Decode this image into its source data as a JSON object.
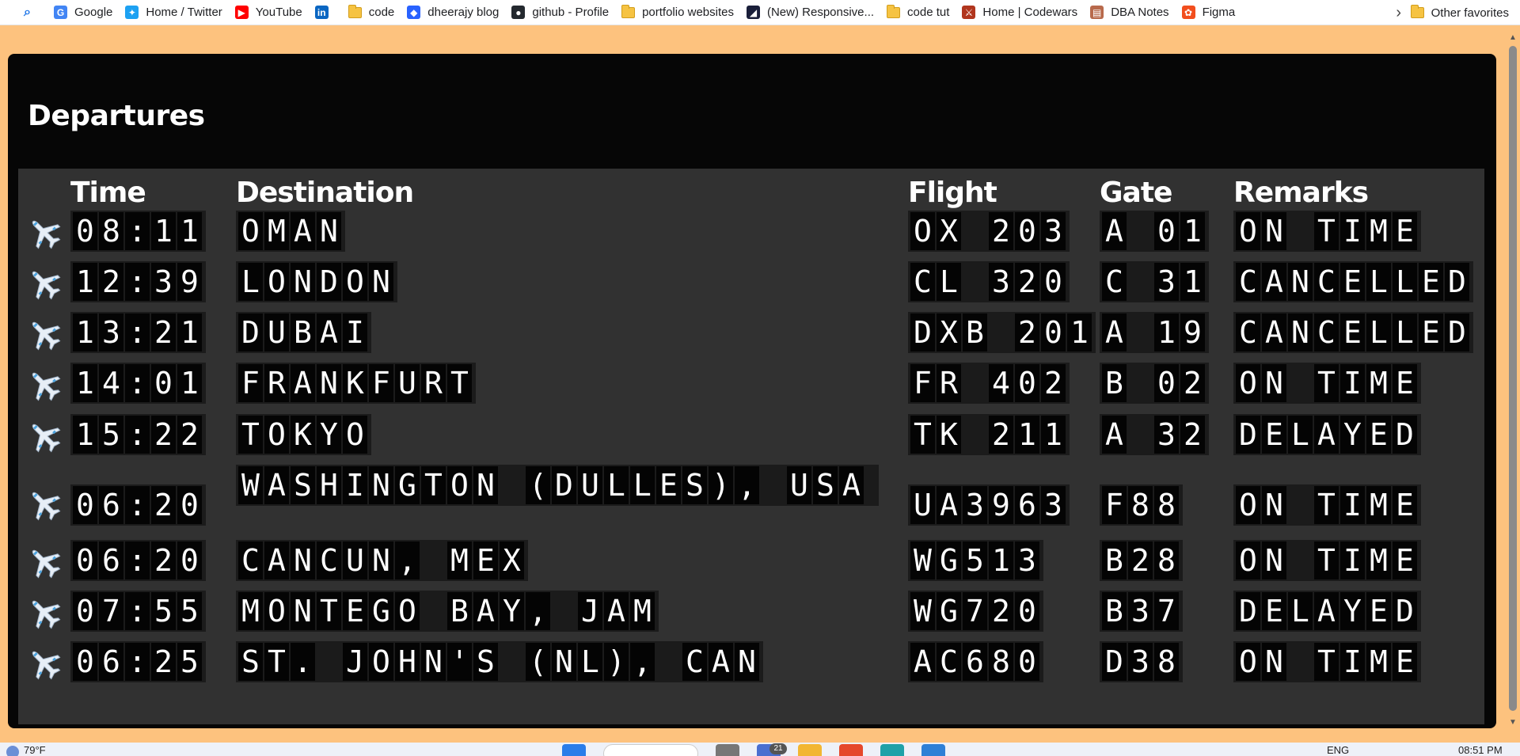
{
  "bookmarks": [
    {
      "label": "",
      "icon": "search-icon",
      "kind": "search"
    },
    {
      "label": "Google",
      "icon": "google-icon",
      "kind": "logo",
      "color": "#4285f4",
      "glyph": "G"
    },
    {
      "label": "Home / Twitter",
      "icon": "twitter-icon",
      "kind": "logo",
      "color": "#1da1f2",
      "glyph": "✦"
    },
    {
      "label": "YouTube",
      "icon": "youtube-icon",
      "kind": "logo",
      "color": "#ff0000",
      "glyph": "▶"
    },
    {
      "label": "",
      "icon": "linkedin-icon",
      "kind": "logo",
      "color": "#0a66c2",
      "glyph": "in"
    },
    {
      "label": "code",
      "icon": "folder-icon",
      "kind": "folder"
    },
    {
      "label": "dheerajy blog",
      "icon": "hashnode-icon",
      "kind": "logo",
      "color": "#2962ff",
      "glyph": "◆"
    },
    {
      "label": "github - Profile",
      "icon": "github-icon",
      "kind": "logo",
      "color": "#24292f",
      "glyph": "●"
    },
    {
      "label": "portfolio websites",
      "icon": "folder-icon",
      "kind": "folder"
    },
    {
      "label": "(New) Responsive...",
      "icon": "frontend-mentor-icon",
      "kind": "logo",
      "color": "#1a1f3a",
      "glyph": "◢"
    },
    {
      "label": "code tut",
      "icon": "folder-icon",
      "kind": "folder"
    },
    {
      "label": "Home | Codewars",
      "icon": "codewars-icon",
      "kind": "logo",
      "color": "#b1361e",
      "glyph": "⚔"
    },
    {
      "label": "DBA Notes",
      "icon": "notes-icon",
      "kind": "logo",
      "color": "#b86a4c",
      "glyph": "▤"
    },
    {
      "label": "Figma",
      "icon": "figma-icon",
      "kind": "logo",
      "color": "#f24e1e",
      "glyph": "✿"
    }
  ],
  "bookmarks_more": "›",
  "other_favorites": "Other favorites",
  "board": {
    "title": "Departures",
    "headers": {
      "time": "Time",
      "destination": "Destination",
      "flight": "Flight",
      "gate": "Gate",
      "remarks": "Remarks"
    },
    "rows": [
      {
        "time": "08:11",
        "destination": "OMAN",
        "flight": "OX 203",
        "gate": "A 01",
        "remarks": "ON TIME"
      },
      {
        "time": "12:39",
        "destination": "LONDON",
        "flight": "CL 320",
        "gate": "C 31",
        "remarks": "CANCELLED"
      },
      {
        "time": "13:21",
        "destination": "DUBAI",
        "flight": "DXB 201",
        "gate": "A 19",
        "remarks": "CANCELLED"
      },
      {
        "time": "14:01",
        "destination": "FRANKFURT",
        "flight": "FR 402",
        "gate": "B 02",
        "remarks": "ON TIME"
      },
      {
        "time": "15:22",
        "destination": "TOKYO",
        "flight": "TK 211",
        "gate": "A 32",
        "remarks": "DELAYED"
      },
      {
        "time": "06:20",
        "destination": "WASHINGTON (DULLES), USA",
        "flight": "UA3963",
        "gate": "F88",
        "remarks": "ON TIME"
      },
      {
        "time": "06:20",
        "destination": "CANCUN, MEX",
        "flight": "WG513",
        "gate": "B28",
        "remarks": "ON TIME"
      },
      {
        "time": "07:55",
        "destination": "MONTEGO BAY, JAM",
        "flight": "WG720",
        "gate": "B37",
        "remarks": "DELAYED"
      },
      {
        "time": "06:25",
        "destination": "ST. JOHN'S (NL), CAN",
        "flight": "AC680",
        "gate": "D38",
        "remarks": "ON TIME"
      }
    ]
  },
  "taskbar": {
    "weather": "79°F",
    "badge": "21",
    "lang": "ENG",
    "clock": "08:51 PM"
  },
  "colors": {
    "page_bg": "#fdc27e",
    "board_bg": "#060606",
    "table_bg": "#313131",
    "tile_bg": "#040404"
  }
}
